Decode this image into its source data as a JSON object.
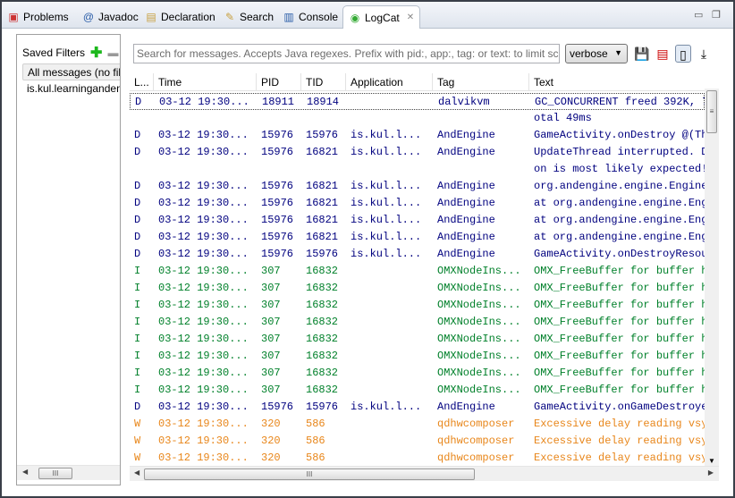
{
  "tabs": [
    {
      "label": "Problems",
      "icon": "problems-icon"
    },
    {
      "label": "Javadoc",
      "icon": "at-icon"
    },
    {
      "label": "Declaration",
      "icon": "declaration-icon"
    },
    {
      "label": "Search",
      "icon": "search-icon"
    },
    {
      "label": "Console",
      "icon": "console-icon"
    },
    {
      "label": "LogCat",
      "icon": "logcat-icon",
      "active": true
    }
  ],
  "filters": {
    "title": "Saved Filters",
    "items": [
      "All messages (no filters)",
      "is.kul.learningandengine"
    ]
  },
  "search": {
    "placeholder": "Search for messages. Accepts Java regexes. Prefix with pid:, app:, tag: or text: to limit scope."
  },
  "level": {
    "value": "verbose"
  },
  "columns": [
    "L...",
    "Time",
    "PID",
    "TID",
    "Application",
    "Tag",
    "Text"
  ],
  "colors": {
    "D": "#00007f",
    "I": "#00802a",
    "W": "#e8861a"
  },
  "rows": [
    [
      "D",
      "03-12 19:30...",
      "18911",
      "18914",
      "",
      "dalvikvm",
      "GC_CONCURRENT freed 392K, 7"
    ],
    [
      "",
      "",
      "",
      "",
      "",
      "",
      "otal 49ms"
    ],
    [
      "D",
      "03-12 19:30...",
      "15976",
      "15976",
      "is.kul.l...",
      "AndEngine",
      "GameActivity.onDestroy @(Th"
    ],
    [
      "D",
      "03-12 19:30...",
      "15976",
      "16821",
      "is.kul.l...",
      "AndEngine",
      "UpdateThread interrupted. D"
    ],
    [
      "",
      "",
      "",
      "",
      "",
      "",
      "on is most likely expected!"
    ],
    [
      "D",
      "03-12 19:30...",
      "15976",
      "16821",
      "is.kul.l...",
      "AndEngine",
      "org.andengine.engine.Engine"
    ],
    [
      "D",
      "03-12 19:30...",
      "15976",
      "16821",
      "is.kul.l...",
      "AndEngine",
      "at org.andengine.engine.Eng"
    ],
    [
      "D",
      "03-12 19:30...",
      "15976",
      "16821",
      "is.kul.l...",
      "AndEngine",
      "at org.andengine.engine.Eng"
    ],
    [
      "D",
      "03-12 19:30...",
      "15976",
      "16821",
      "is.kul.l...",
      "AndEngine",
      "at org.andengine.engine.Eng"
    ],
    [
      "D",
      "03-12 19:30...",
      "15976",
      "15976",
      "is.kul.l...",
      "AndEngine",
      "GameActivity.onDestroyResou"
    ],
    [
      "I",
      "03-12 19:30...",
      "307",
      "16832",
      "",
      "OMXNodeIns...",
      "OMX_FreeBuffer for buffer h"
    ],
    [
      "I",
      "03-12 19:30...",
      "307",
      "16832",
      "",
      "OMXNodeIns...",
      "OMX_FreeBuffer for buffer h"
    ],
    [
      "I",
      "03-12 19:30...",
      "307",
      "16832",
      "",
      "OMXNodeIns...",
      "OMX_FreeBuffer for buffer h"
    ],
    [
      "I",
      "03-12 19:30...",
      "307",
      "16832",
      "",
      "OMXNodeIns...",
      "OMX_FreeBuffer for buffer h"
    ],
    [
      "I",
      "03-12 19:30...",
      "307",
      "16832",
      "",
      "OMXNodeIns...",
      "OMX_FreeBuffer for buffer h"
    ],
    [
      "I",
      "03-12 19:30...",
      "307",
      "16832",
      "",
      "OMXNodeIns...",
      "OMX_FreeBuffer for buffer h"
    ],
    [
      "I",
      "03-12 19:30...",
      "307",
      "16832",
      "",
      "OMXNodeIns...",
      "OMX_FreeBuffer for buffer h"
    ],
    [
      "I",
      "03-12 19:30...",
      "307",
      "16832",
      "",
      "OMXNodeIns...",
      "OMX_FreeBuffer for buffer h"
    ],
    [
      "D",
      "03-12 19:30...",
      "15976",
      "15976",
      "is.kul.l...",
      "AndEngine",
      "GameActivity.onGameDestroye"
    ],
    [
      "W",
      "03-12 19:30...",
      "320",
      "586",
      "",
      "qdhwcomposer",
      "Excessive delay reading vsy"
    ],
    [
      "W",
      "03-12 19:30...",
      "320",
      "586",
      "",
      "qdhwcomposer",
      "Excessive delay reading vsy"
    ],
    [
      "W",
      "03-12 19:30...",
      "320",
      "586",
      "",
      "qdhwcomposer",
      "Excessive delay reading vsy"
    ]
  ]
}
